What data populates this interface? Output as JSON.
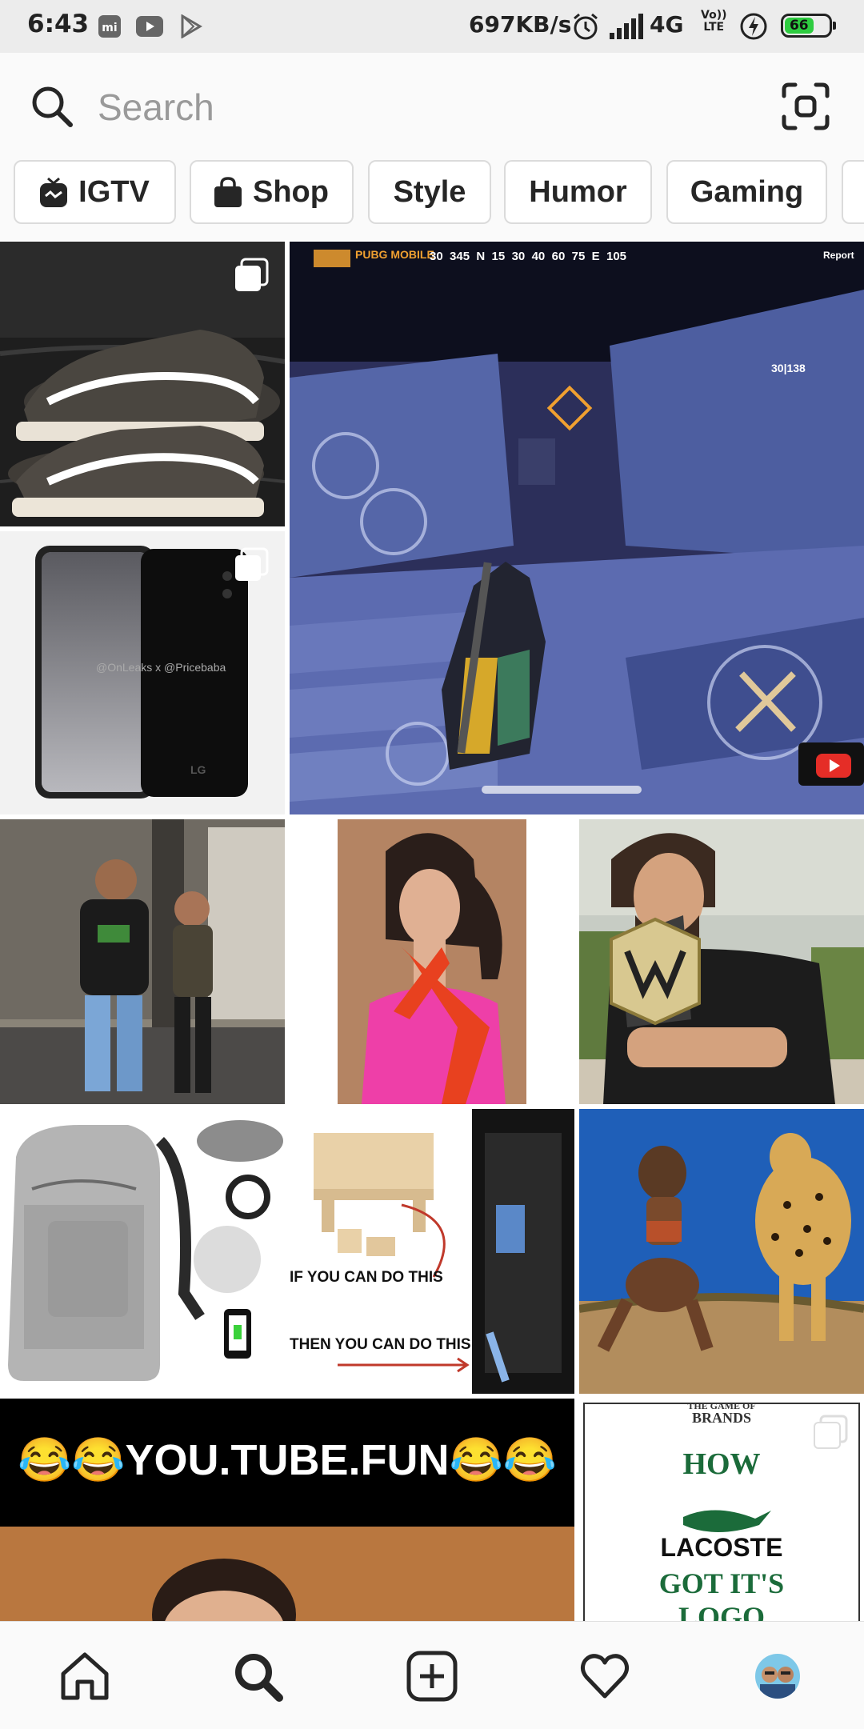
{
  "status_bar": {
    "time": "6:43",
    "speed": "697KB/s",
    "network": "4G",
    "volte_line1": "Vo))",
    "volte_line2": "LTE",
    "battery": "66",
    "battery_level": 0.66,
    "battery_color": "#2ecc40",
    "app_icons": [
      "mi-icon",
      "youtube-icon",
      "play-store-icon"
    ]
  },
  "search": {
    "placeholder": "Search"
  },
  "chips": [
    {
      "label": "IGTV",
      "icon": "igtv-icon"
    },
    {
      "label": "Shop",
      "icon": "shopping-bag-icon"
    },
    {
      "label": "Style"
    },
    {
      "label": "Humor"
    },
    {
      "label": "Gaming"
    }
  ],
  "tiles": {
    "meme_banner": "😂😂YOU.TUBE.FUN😂😂",
    "diy_line1": "IF YOU CAN DO THIS",
    "diy_line2": "THEN YOU CAN DO THIS",
    "brand_header_small": "THE GAME OF",
    "brand_header_big": "BRANDS",
    "brand_how": "HOW",
    "brand_name": "LACOSTE",
    "brand_got": "GOT IT'S",
    "brand_logo": "LOGO",
    "pubg_logo": "PUBG MOBILE",
    "pubg_compass": "30  345  N  15  30  40  60  75  E  105",
    "pubg_report": "Report",
    "pubg_ammo": "30|138",
    "phone_watermark": "@OnLeaks x @Pricebaba",
    "phone_brand": "LG"
  },
  "colors": {
    "accent": "#262626",
    "chip_border": "#dbdbdb",
    "brand_green": "#1b6b3a"
  },
  "nav": {
    "items": [
      "home-icon",
      "search-icon",
      "add-post-icon",
      "heart-icon",
      "profile-avatar"
    ],
    "active": "search-icon"
  }
}
